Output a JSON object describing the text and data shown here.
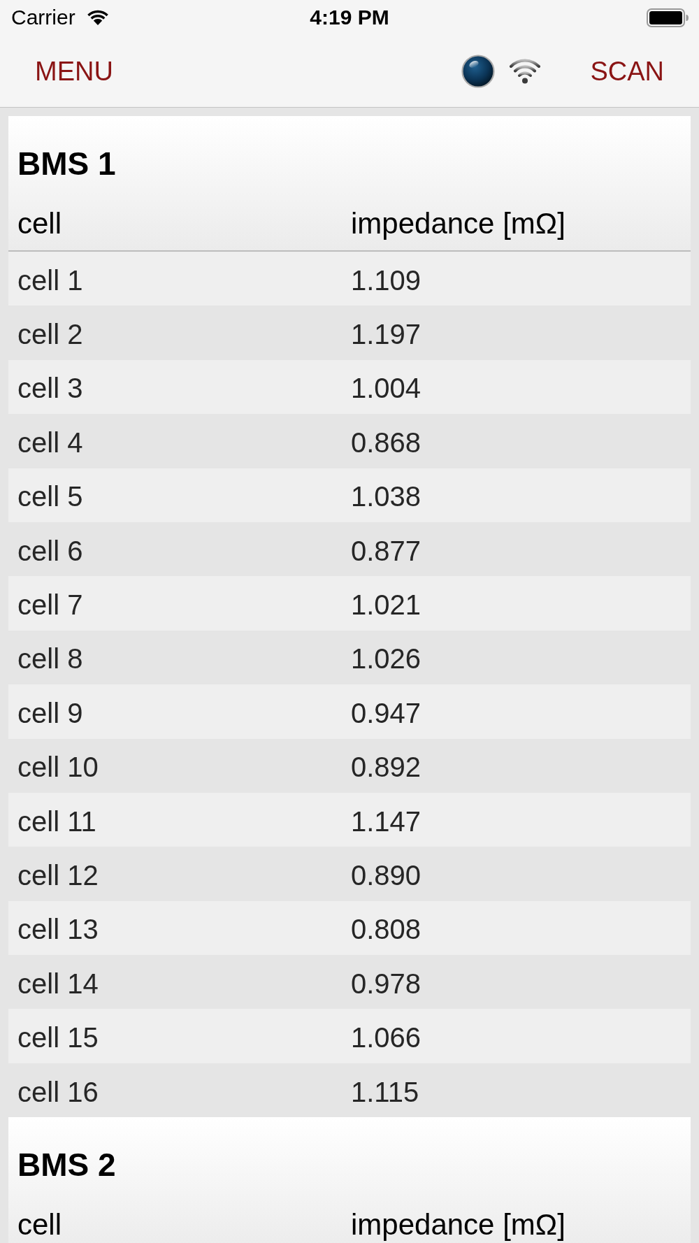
{
  "status_bar": {
    "carrier": "Carrier",
    "time": "4:19 PM"
  },
  "nav_bar": {
    "menu_button": "MENU",
    "scan_button": "SCAN"
  },
  "sections": [
    {
      "title": "BMS 1",
      "columns": [
        "cell",
        "impedance [mΩ]"
      ],
      "rows": [
        {
          "cell": "cell 1",
          "impedance": "1.109"
        },
        {
          "cell": "cell 2",
          "impedance": "1.197"
        },
        {
          "cell": "cell 3",
          "impedance": "1.004"
        },
        {
          "cell": "cell 4",
          "impedance": "0.868"
        },
        {
          "cell": "cell 5",
          "impedance": "1.038"
        },
        {
          "cell": "cell 6",
          "impedance": "0.877"
        },
        {
          "cell": "cell 7",
          "impedance": "1.021"
        },
        {
          "cell": "cell 8",
          "impedance": "1.026"
        },
        {
          "cell": "cell 9",
          "impedance": "0.947"
        },
        {
          "cell": "cell 10",
          "impedance": "0.892"
        },
        {
          "cell": "cell 11",
          "impedance": "1.147"
        },
        {
          "cell": "cell 12",
          "impedance": "0.890"
        },
        {
          "cell": "cell 13",
          "impedance": "0.808"
        },
        {
          "cell": "cell 14",
          "impedance": "0.978"
        },
        {
          "cell": "cell 15",
          "impedance": "1.066"
        },
        {
          "cell": "cell 16",
          "impedance": "1.115"
        }
      ]
    },
    {
      "title": "BMS 2",
      "columns": [
        "cell",
        "impedance [mΩ]"
      ]
    }
  ]
}
